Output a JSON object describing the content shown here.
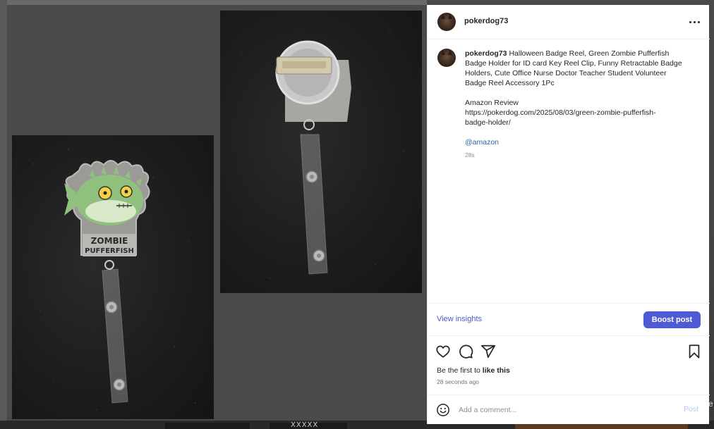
{
  "post": {
    "username": "pokerdog73",
    "caption": {
      "lines": [
        "Halloween Badge Reel, Green Zombie Pufferfish",
        "Badge Holder for ID card Key Reel Clip, Funny Retractable Badge",
        "Holders, Cute Office Nurse Doctor Teacher Student Volunteer",
        "Badge Reel Accessory 1Pc"
      ],
      "review_label": "Amazon Review",
      "link_line1": "https://pokerdog.com/2025/08/03/green-zombie-pufferfish-",
      "link_line2": "badge-holder/",
      "mention": "@amazon",
      "relative_time": "28s"
    },
    "badge_text_line1": "ZOMBIE",
    "badge_text_line2": "PUFFERFISH"
  },
  "insights": {
    "view_label": "View insights",
    "boost_label": "Boost post"
  },
  "actions": {
    "icons": [
      "heart-icon",
      "comment-icon",
      "share-icon",
      "bookmark-icon"
    ]
  },
  "likes": {
    "prefix": "Be the first to ",
    "action": "like this"
  },
  "post_time": "28 seconds ago",
  "comment": {
    "placeholder": "Add a comment...",
    "post_label": "Post"
  },
  "background": {
    "fragment_text": "XXXXX",
    "edge_text": "e"
  },
  "colors": {
    "accent": "#4f5bd5",
    "link": "#4a5bc7",
    "mention": "#2f5ea8",
    "post_disabled": "#b2c7f5",
    "badge_green": "#8fc07e"
  }
}
